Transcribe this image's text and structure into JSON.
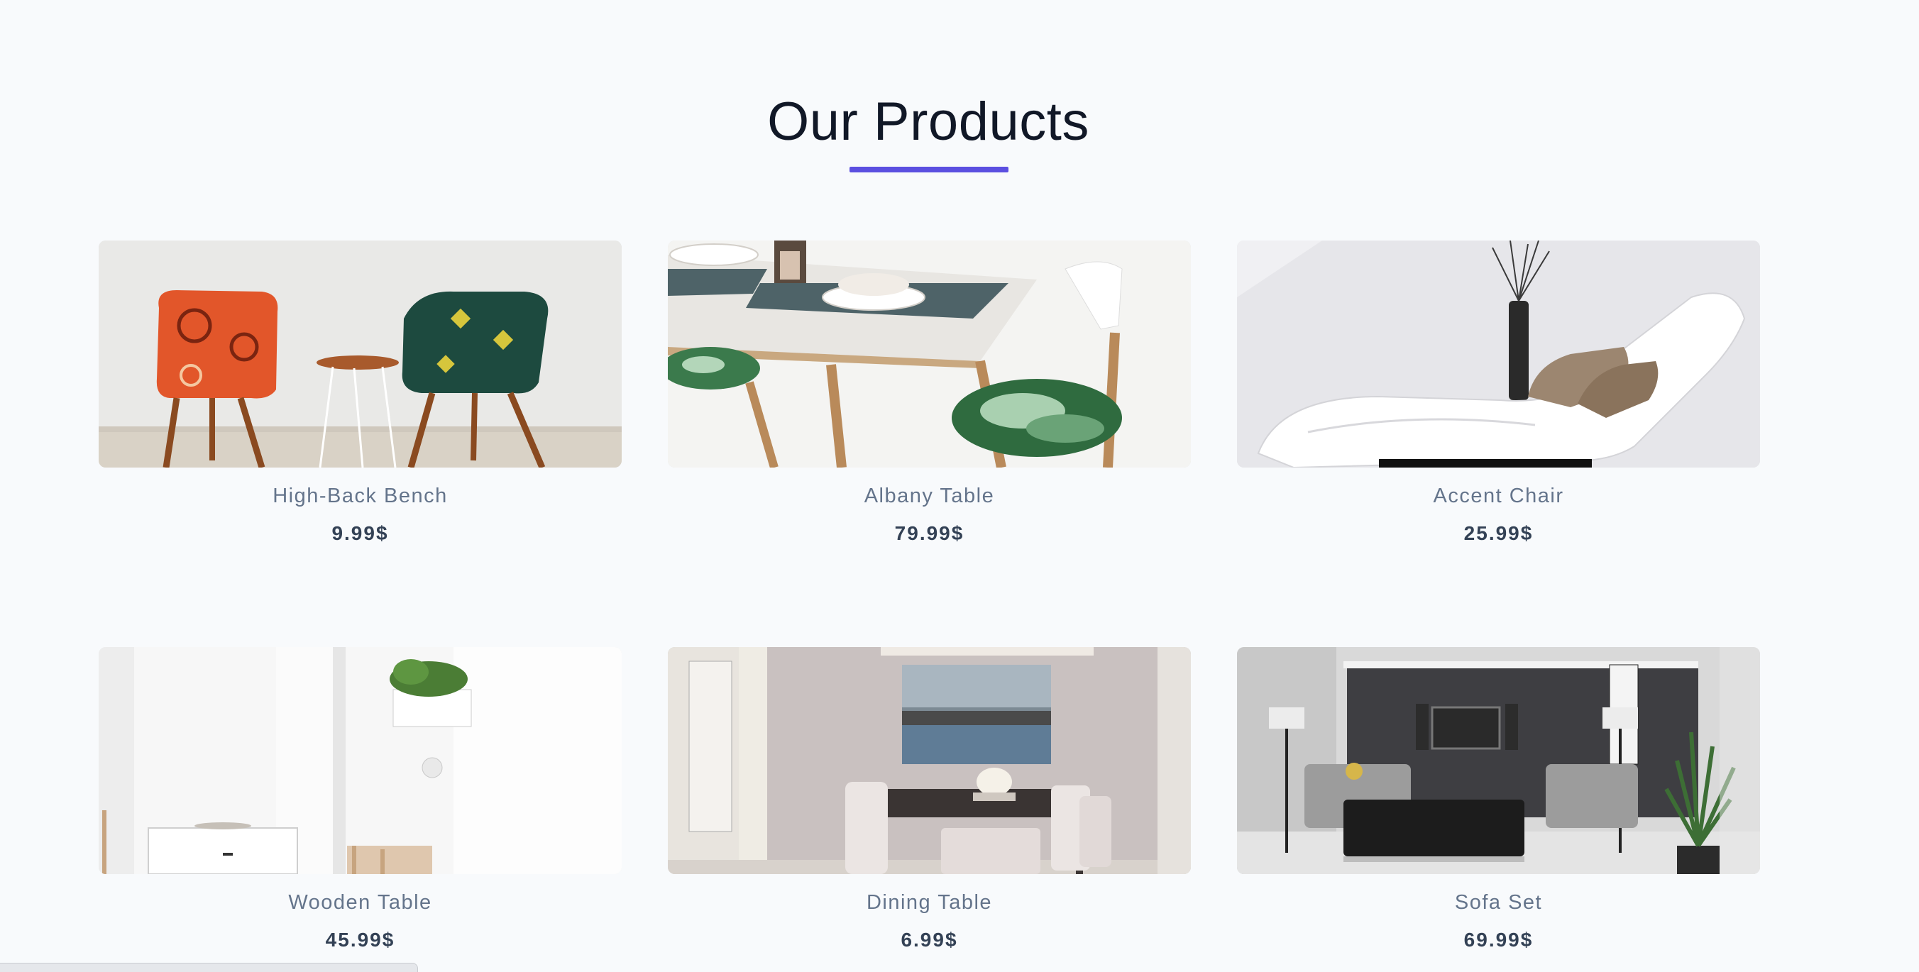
{
  "section": {
    "title": "Our Products"
  },
  "products": [
    {
      "name": "High-Back Bench",
      "price": "9.99$",
      "image_icon": "two-patterned-chairs-photo"
    },
    {
      "name": "Albany Table",
      "price": "79.99$",
      "image_icon": "dining-table-with-plates-photo"
    },
    {
      "name": "Accent Chair",
      "price": "25.99$",
      "image_icon": "white-lounge-chair-photo"
    },
    {
      "name": "Wooden Table",
      "price": "45.99$",
      "image_icon": "white-room-with-plant-photo"
    },
    {
      "name": "Dining Table",
      "price": "6.99$",
      "image_icon": "dining-room-photo"
    },
    {
      "name": "Sofa Set",
      "price": "69.99$",
      "image_icon": "living-room-sofa-photo"
    }
  ],
  "colors": {
    "accent": "#5b4fe0",
    "title": "#111827",
    "name": "#64748b",
    "price": "#334155",
    "background": "#f8fafc"
  }
}
